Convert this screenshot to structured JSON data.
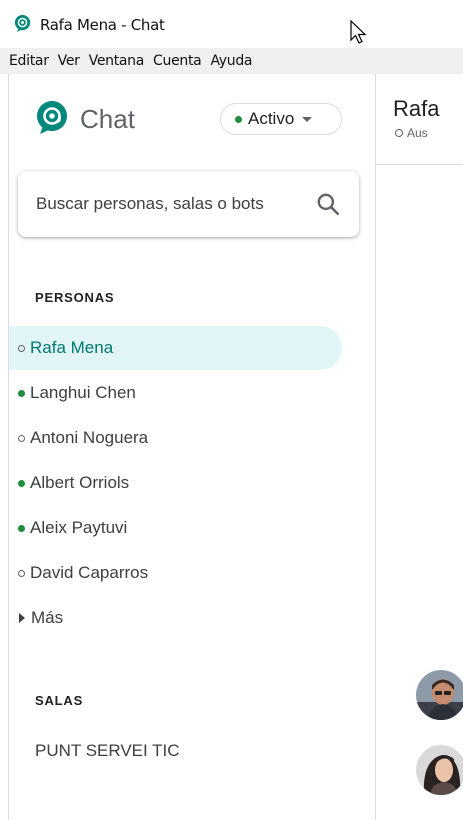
{
  "window": {
    "title": "Rafa Mena - Chat"
  },
  "menu": [
    "Editar",
    "Ver",
    "Ventana",
    "Cuenta",
    "Ayuda"
  ],
  "sidebar": {
    "app_name": "Chat",
    "status_label": "Activo",
    "search_placeholder": "Buscar personas, salas o bots",
    "people_heading": "PERSONAS",
    "people": [
      {
        "name": "Rafa Mena",
        "status": "away",
        "selected": true
      },
      {
        "name": "Langhui Chen",
        "status": "online",
        "selected": false
      },
      {
        "name": "Antoni Noguera",
        "status": "away",
        "selected": false
      },
      {
        "name": "Albert Orriols",
        "status": "online",
        "selected": false
      },
      {
        "name": "Aleix Paytuvi",
        "status": "online",
        "selected": false
      },
      {
        "name": "David Caparros",
        "status": "away",
        "selected": false
      }
    ],
    "more_label": "Más",
    "rooms_heading": "SALAS",
    "rooms": [
      "PUNT SERVEI TIC"
    ]
  },
  "conversation": {
    "header_name": "Rafa",
    "header_status": "Aus"
  },
  "colors": {
    "accent": "#00796b",
    "online": "#1e8e3e",
    "selected_bg": "#e1f5f8"
  }
}
